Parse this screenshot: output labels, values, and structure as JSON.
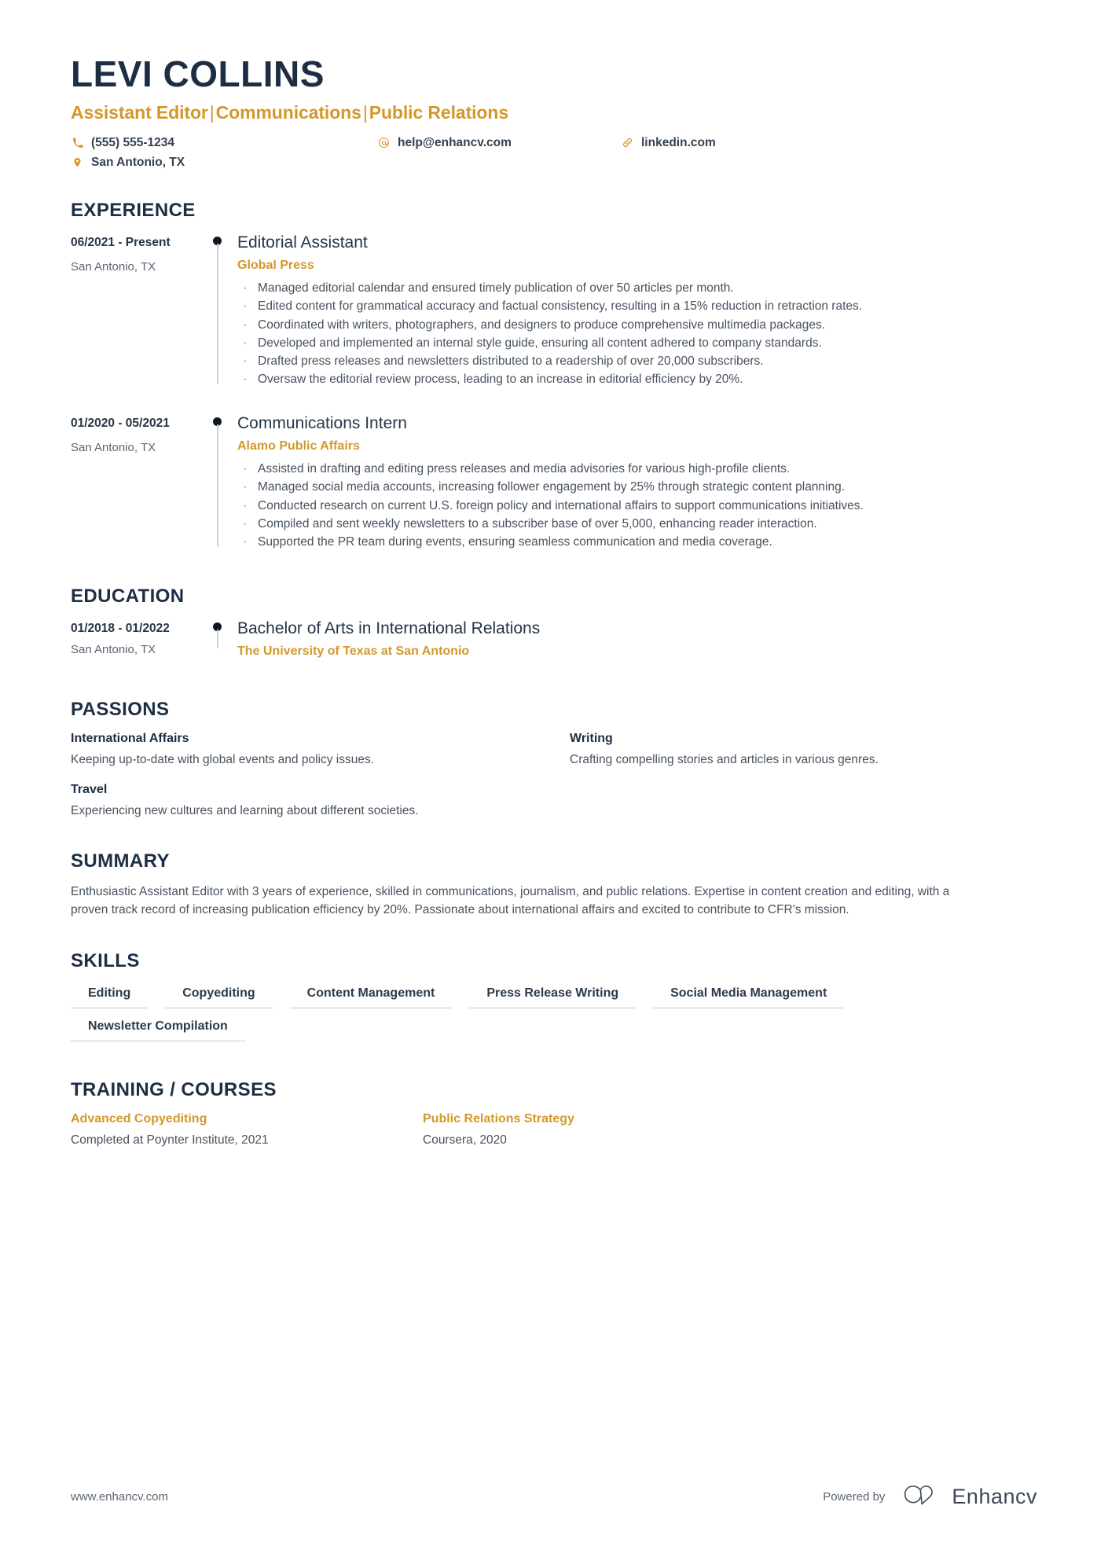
{
  "header": {
    "name": "LEVI COLLINS",
    "headline_parts": [
      "Assistant Editor",
      "Communications",
      "Public Relations"
    ],
    "headline_separator": "|",
    "contacts": [
      {
        "icon": "phone-icon",
        "value": "(555) 555-1234"
      },
      {
        "icon": "email-icon",
        "value": "help@enhancv.com"
      },
      {
        "icon": "link-icon",
        "value": "linkedin.com"
      },
      {
        "icon": "location-icon",
        "value": "San Antonio, TX"
      }
    ]
  },
  "colors": {
    "accent_gold": "#d4982a",
    "heading_navy": "#1d2e44",
    "body_gray": "#48525f"
  },
  "experience": {
    "title": "EXPERIENCE",
    "entries": [
      {
        "date": "06/2021 - Present",
        "location": "San Antonio, TX",
        "role": "Editorial Assistant",
        "company": "Global Press",
        "bullets": [
          "Managed editorial calendar and ensured timely publication of over 50 articles per month.",
          "Edited content for grammatical accuracy and factual consistency, resulting in a 15% reduction in retraction rates.",
          "Coordinated with writers, photographers, and designers to produce comprehensive multimedia packages.",
          "Developed and implemented an internal style guide, ensuring all content adhered to company standards.",
          "Drafted press releases and newsletters distributed to a readership of over 20,000 subscribers.",
          "Oversaw the editorial review process, leading to an increase in editorial efficiency by 20%."
        ]
      },
      {
        "date": "01/2020 - 05/2021",
        "location": "San Antonio, TX",
        "role": "Communications Intern",
        "company": "Alamo Public Affairs",
        "bullets": [
          "Assisted in drafting and editing press releases and media advisories for various high-profile clients.",
          "Managed social media accounts, increasing follower engagement by 25% through strategic content planning.",
          "Conducted research on current U.S. foreign policy and international affairs to support communications initiatives.",
          "Compiled and sent weekly newsletters to a subscriber base of over 5,000, enhancing reader interaction.",
          "Supported the PR team during events, ensuring seamless communication and media coverage."
        ]
      }
    ]
  },
  "education": {
    "title": "EDUCATION",
    "entries": [
      {
        "date": "01/2018 - 01/2022",
        "location": "San Antonio, TX",
        "degree": "Bachelor of Arts in International Relations",
        "school": "The University of Texas at San Antonio"
      }
    ]
  },
  "passions": {
    "title": "PASSIONS",
    "items": [
      {
        "name": "International Affairs",
        "description": "Keeping up-to-date with global events and policy issues."
      },
      {
        "name": "Writing",
        "description": "Crafting compelling stories and articles in various genres."
      },
      {
        "name": "Travel",
        "description": "Experiencing new cultures and learning about different societies."
      }
    ]
  },
  "summary": {
    "title": "SUMMARY",
    "text": "Enthusiastic Assistant Editor with 3 years of experience, skilled in communications, journalism, and public relations. Expertise in content creation and editing, with a proven track record of increasing publication efficiency by 20%. Passionate about international affairs and excited to contribute to CFR's mission."
  },
  "skills": {
    "title": "SKILLS",
    "items": [
      "Editing",
      "Copyediting",
      "Content Management",
      "Press Release Writing",
      "Social Media Management",
      "Newsletter Compilation"
    ]
  },
  "training": {
    "title": "TRAINING / COURSES",
    "items": [
      {
        "name": "Advanced Copyediting",
        "description": "Completed at Poynter Institute, 2021"
      },
      {
        "name": "Public Relations Strategy",
        "description": "Coursera, 2020"
      }
    ]
  },
  "footer": {
    "url": "www.enhancv.com",
    "powered_by": "Powered by",
    "brand": "Enhancv"
  }
}
